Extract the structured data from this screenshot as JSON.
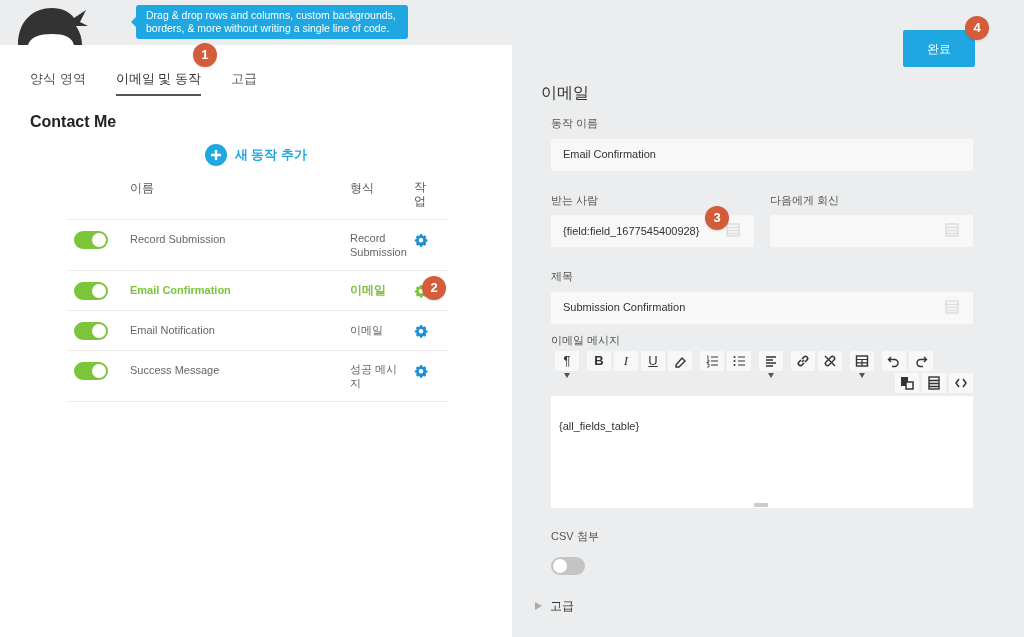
{
  "banner": {
    "tooltip": "Drag & drop rows and columns, custom backgrounds, borders, & more without writing a single line of code."
  },
  "tabs": [
    {
      "label": "양식 영역",
      "selected": false
    },
    {
      "label": "이메일 및 동작",
      "selected": true,
      "callout": "1"
    },
    {
      "label": "고급",
      "selected": false
    }
  ],
  "form_title": "Contact Me",
  "add_action": "새 동작 추가",
  "actions_table": {
    "columns": [
      "이름",
      "형식",
      "작\n업"
    ],
    "rows": [
      {
        "on": true,
        "name": "Record Submission",
        "type": "Record\nSubmission",
        "selected": false
      },
      {
        "on": true,
        "name": "Email Confirmation",
        "type": "이메일",
        "selected": true,
        "callout": "2"
      },
      {
        "on": true,
        "name": "Email Notification",
        "type": "이메일",
        "selected": false
      },
      {
        "on": true,
        "name": "Success Message",
        "type": "성공 메시\n지",
        "selected": false
      }
    ]
  },
  "done_button": {
    "label": "완료",
    "callout": "4"
  },
  "editor": {
    "title": "이메일",
    "action_name": {
      "label": "동작 이름",
      "value": "Email Confirmation"
    },
    "to": {
      "label": "받는 사람",
      "value": "{field:field_1677545400928}",
      "callout": "3"
    },
    "reply_to": {
      "label": "다음에게 회신"
    },
    "subject": {
      "label": "제목",
      "value": "Submission Confirmation"
    },
    "message": {
      "label": "이메일 메시지",
      "body": "{all_fields_table}",
      "toolbar": [
        {
          "label": "¶",
          "dropdown": true
        },
        {
          "label": "B",
          "dropdown": false
        },
        {
          "label": "I",
          "dropdown": false
        },
        {
          "label": "U",
          "dropdown": false
        },
        {
          "dropdown": false
        },
        {
          "dropdown": false
        },
        {
          "dropdown": false
        },
        {
          "dropdown": true
        },
        {
          "dropdown": false
        },
        {
          "dropdown": false
        },
        {
          "dropdown": true
        },
        {
          "dropdown": false
        },
        {
          "dropdown": false
        }
      ]
    },
    "csv_attach": {
      "label": "CSV 첨부",
      "on": false
    },
    "advanced": {
      "label": "고급",
      "expanded": false
    }
  }
}
